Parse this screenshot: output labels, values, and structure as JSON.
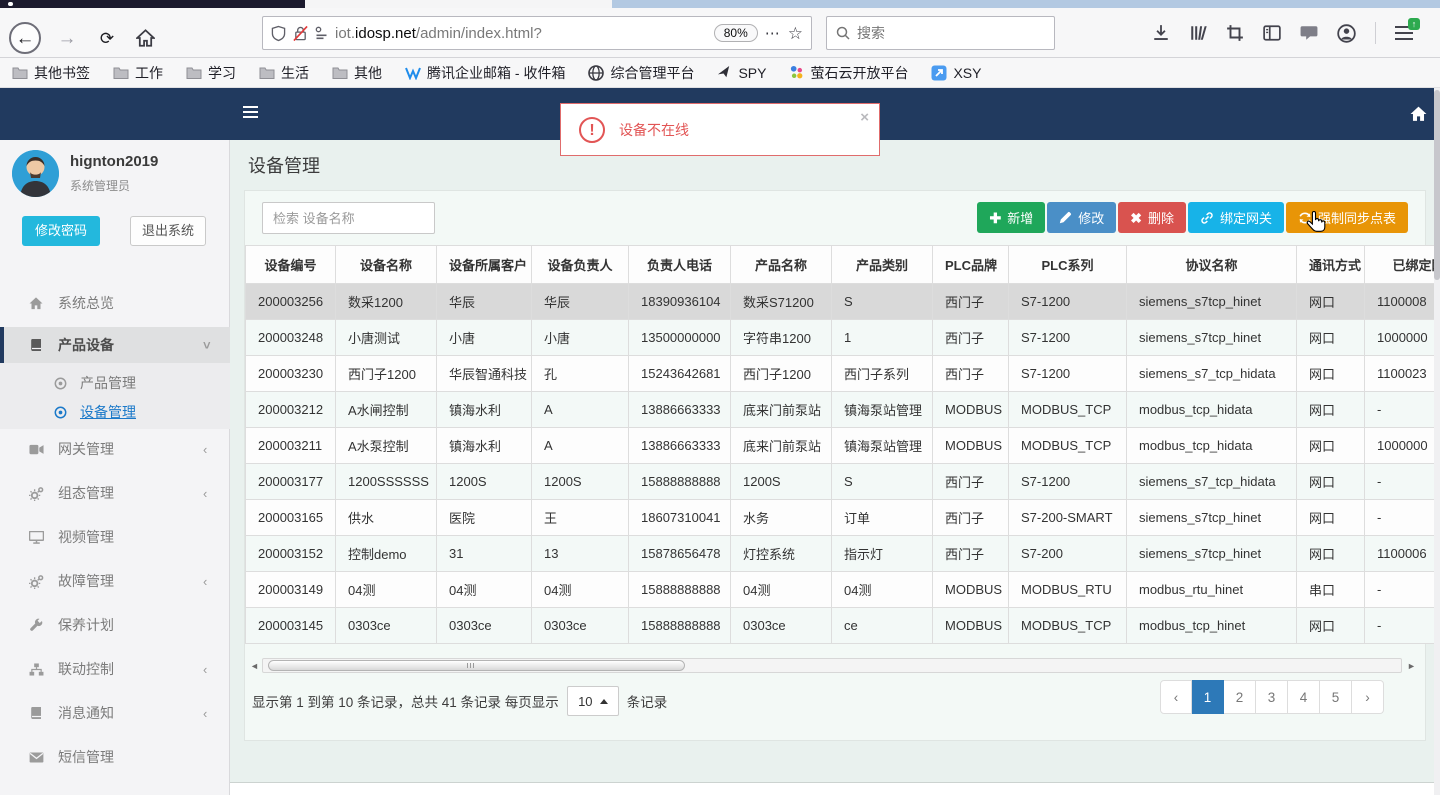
{
  "browser": {
    "url_prefix": "iot.",
    "url_domain": "idosp.net",
    "url_path": "/admin/index.html?",
    "zoom_badge": "80%",
    "page_actions": "⋯",
    "star": "☆",
    "search_placeholder": "搜索",
    "bookmarks": [
      {
        "label": "其他书签"
      },
      {
        "label": "工作"
      },
      {
        "label": "学习"
      },
      {
        "label": "生活"
      },
      {
        "label": "其他"
      },
      {
        "label": "腾讯企业邮箱 - 收件箱"
      },
      {
        "label": "综合管理平台"
      },
      {
        "label": "SPY"
      },
      {
        "label": "萤石云开放平台"
      },
      {
        "label": "XSY"
      }
    ]
  },
  "app": {
    "alert": {
      "text": "设备不在线",
      "close": "×"
    },
    "sidebar": {
      "username": "hignton2019",
      "role": "系统管理员",
      "change_password": "修改密码",
      "logout": "退出系统",
      "menu": [
        {
          "label": "系统总览"
        },
        {
          "label": "产品设备",
          "chevron": "˅"
        },
        {
          "label": "产品管理"
        },
        {
          "label": "设备管理"
        },
        {
          "label": "网关管理",
          "chevron": "‹"
        },
        {
          "label": "组态管理",
          "chevron": "‹"
        },
        {
          "label": "视频管理"
        },
        {
          "label": "故障管理",
          "chevron": "‹"
        },
        {
          "label": "保养计划"
        },
        {
          "label": "联动控制",
          "chevron": "‹"
        },
        {
          "label": "消息通知",
          "chevron": "‹"
        },
        {
          "label": "短信管理"
        }
      ]
    },
    "main": {
      "title": "设备管理",
      "search_placeholder": "检索 设备名称",
      "buttons": {
        "add": "新增",
        "edit": "修改",
        "delete": "删除",
        "bind": "绑定网关",
        "sync": "强制同步点表"
      },
      "table": {
        "columns": [
          "设备编号",
          "设备名称",
          "设备所属客户",
          "设备负责人",
          "负责人电话",
          "产品名称",
          "产品类别",
          "PLC品牌",
          "PLC系列",
          "协议名称",
          "通讯方式",
          "已绑定网关"
        ],
        "rows": [
          [
            "200003256",
            "数采1200",
            "华辰",
            "华辰",
            "18390936104",
            "数采S71200",
            "S",
            "西门子",
            "S7-1200",
            "siemens_s7tcp_hinet",
            "网口",
            "1100008"
          ],
          [
            "200003248",
            "小唐测试",
            "小唐",
            "小唐",
            "13500000000",
            "字符串1200",
            "1",
            "西门子",
            "S7-1200",
            "siemens_s7tcp_hinet",
            "网口",
            "1000000"
          ],
          [
            "200003230",
            "西门子1200",
            "华辰智通科技",
            "孔",
            "15243642681",
            "西门子1200",
            "西门子系列",
            "西门子",
            "S7-1200",
            "siemens_s7_tcp_hidata",
            "网口",
            "1100023"
          ],
          [
            "200003212",
            "A水闸控制",
            "镇海水利",
            "A",
            "13886663333",
            "底来门前泵站",
            "镇海泵站管理",
            "MODBUS",
            "MODBUS_TCP",
            "modbus_tcp_hidata",
            "网口",
            "-"
          ],
          [
            "200003211",
            "A水泵控制",
            "镇海水利",
            "A",
            "13886663333",
            "底来门前泵站",
            "镇海泵站管理",
            "MODBUS",
            "MODBUS_TCP",
            "modbus_tcp_hidata",
            "网口",
            "1000000"
          ],
          [
            "200003177",
            "1200SSSSSS",
            "1200S",
            "1200S",
            "15888888888",
            "1200S",
            "S",
            "西门子",
            "S7-1200",
            "siemens_s7_tcp_hidata",
            "网口",
            "-"
          ],
          [
            "200003165",
            "供水",
            "医院",
            "王",
            "18607310041",
            "水务",
            "订单",
            "西门子",
            "S7-200-SMART",
            "siemens_s7tcp_hinet",
            "网口",
            "-"
          ],
          [
            "200003152",
            "控制demo",
            "31",
            "13",
            "15878656478",
            "灯控系统",
            "指示灯",
            "西门子",
            "S7-200",
            "siemens_s7tcp_hinet",
            "网口",
            "1100006"
          ],
          [
            "200003149",
            "04测",
            "04测",
            "04测",
            "15888888888",
            "04测",
            "04测",
            "MODBUS",
            "MODBUS_RTU",
            "modbus_rtu_hinet",
            "串口",
            "-"
          ],
          [
            "200003145",
            "0303ce",
            "0303ce",
            "0303ce",
            "15888888888",
            "0303ce",
            "ce",
            "MODBUS",
            "MODBUS_TCP",
            "modbus_tcp_hinet",
            "网口",
            "-"
          ]
        ],
        "selected_row_index": 0
      },
      "pagination": {
        "info": "显示第 1 到第 10 条记录，总共 41 条记录 每页显示",
        "page_size": "10",
        "suffix": "条记录",
        "prev": "‹",
        "next": "›",
        "pages": [
          "1",
          "2",
          "3",
          "4",
          "5"
        ],
        "active_page": "1"
      }
    },
    "colors": {
      "navbar_navy": "#213a5f",
      "btn_green": "#1fa75a",
      "btn_blue": "#4a8fc7",
      "btn_red": "#d9534f",
      "btn_cyan": "#17b3e8",
      "btn_orange": "#e89507",
      "alert_red": "#e25555",
      "active_page_blue": "#2d79b8",
      "selected_row_gray": "#d9d9d9"
    }
  }
}
